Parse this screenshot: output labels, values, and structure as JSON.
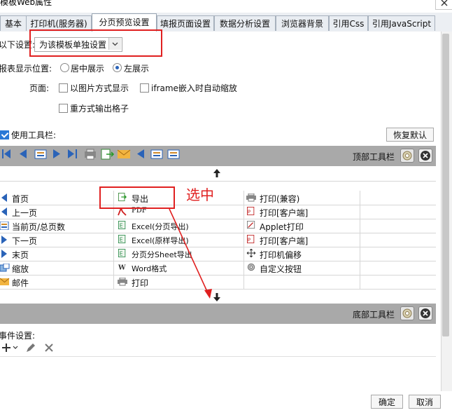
{
  "window": {
    "title": "模板Web属性"
  },
  "tabs": [
    {
      "label": "基本"
    },
    {
      "label": "打印机(服务器)"
    },
    {
      "label": "分页预览设置"
    },
    {
      "label": "填报页面设置"
    },
    {
      "label": "数据分析设置"
    },
    {
      "label": "浏览器背景"
    },
    {
      "label": "引用Css"
    },
    {
      "label": "引用JavaScript"
    }
  ],
  "settings": {
    "label": "以下设置:",
    "select_value": "为该模板单独设置"
  },
  "position": {
    "label": "报表显示位置:",
    "option_center": "居中展示",
    "option_left": "左展示",
    "selected": "左展示"
  },
  "page": {
    "label": "页面:",
    "image_mode": "以图片方式显示",
    "iframe_zoom": "iframe嵌入时自动缩放",
    "repeat_output": "重方式输出格子"
  },
  "toolbar": {
    "use_label": "使用工具栏:",
    "restore_button": "恢复默认",
    "top_label": "顶部工具栏",
    "bottom_label": "底部工具栏"
  },
  "buttons": {
    "col1": [
      "首页",
      "上一页",
      "当前页/总页数",
      "下一页",
      "末页",
      "缩放",
      "邮件"
    ],
    "col2": [
      "导出",
      "PDF",
      "Excel(分页导出)",
      "Excel(原样导出)",
      "分页分Sheet导出",
      "Word格式",
      "打印"
    ],
    "col3": [
      "打印(兼容)",
      "打印[客户端]",
      "Applet打印",
      "打印[客户端]",
      "打印机偏移",
      "自定义按钮"
    ]
  },
  "annotation": {
    "text": "选中"
  },
  "events": {
    "label": "事件设置:"
  },
  "footer": {
    "ok": "确定",
    "cancel": "取消"
  },
  "colors": {
    "highlight": "#e02020",
    "bar": "#a9a9a9",
    "accent": "#2a78d6"
  }
}
